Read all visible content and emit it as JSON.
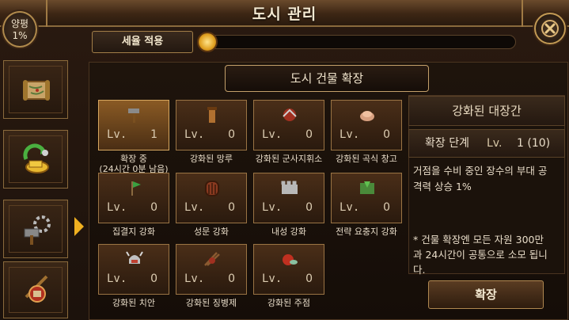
{
  "header": {
    "title": "도시 관리"
  },
  "badge": {
    "line1": "양평",
    "line2": "1%"
  },
  "tax": {
    "button_label": "세율 적용",
    "slider_value_fraction": 0.0
  },
  "section": {
    "title": "도시 건물 확장"
  },
  "tiles": [
    {
      "level_prefix": "Lv.",
      "level": "1",
      "name": "확장 중",
      "sub": "(24시간 0분 남음)",
      "icon": "hammer-icon",
      "active": true
    },
    {
      "level_prefix": "Lv.",
      "level": "0",
      "name": "강화된 망루",
      "icon": "watchtower-icon"
    },
    {
      "level_prefix": "Lv.",
      "level": "0",
      "name": "강화된 군사지휘소",
      "icon": "command-post-icon"
    },
    {
      "level_prefix": "Lv.",
      "level": "0",
      "name": "강화된 곡식 창고",
      "icon": "granary-icon"
    },
    {
      "level_prefix": "Lv.",
      "level": "0",
      "name": "집결지 강화",
      "icon": "rally-flag-icon"
    },
    {
      "level_prefix": "Lv.",
      "level": "0",
      "name": "성문 강화",
      "icon": "gate-icon"
    },
    {
      "level_prefix": "Lv.",
      "level": "0",
      "name": "내성 강화",
      "icon": "inner-wall-icon"
    },
    {
      "level_prefix": "Lv.",
      "level": "0",
      "name": "전략 요충지 강화",
      "icon": "strategic-point-icon"
    },
    {
      "level_prefix": "Lv.",
      "level": "0",
      "name": "강화된 치안",
      "icon": "security-helmet-icon"
    },
    {
      "level_prefix": "Lv.",
      "level": "0",
      "name": "강화된 징병제",
      "icon": "conscription-icon"
    },
    {
      "level_prefix": "Lv.",
      "level": "0",
      "name": "강화된 주점",
      "icon": "tavern-icon"
    }
  ],
  "detail": {
    "title": "강화된 대장간",
    "step_label": "확장 단계",
    "step_prefix": "Lv.",
    "step_value": "1 (10)",
    "desc_line1": "거점을 수비 중인 장수의 부대 공",
    "desc_line2": "격력 상승 1%",
    "note_line1": "* 건물 확장엔 모든 자원 300만",
    "note_line2": "과 24시간이 공통으로 소모 됩니",
    "note_line3": "다.",
    "expand_label": "확장"
  },
  "sidebar": [
    {
      "icon": "map-scroll-icon"
    },
    {
      "icon": "gold-exchange-icon"
    },
    {
      "icon": "blacksmith-icon"
    },
    {
      "icon": "soldier-icon"
    }
  ],
  "colors": {
    "accent": "#f0b020",
    "border": "#9a7444",
    "active_tile": "#8a5a24"
  }
}
